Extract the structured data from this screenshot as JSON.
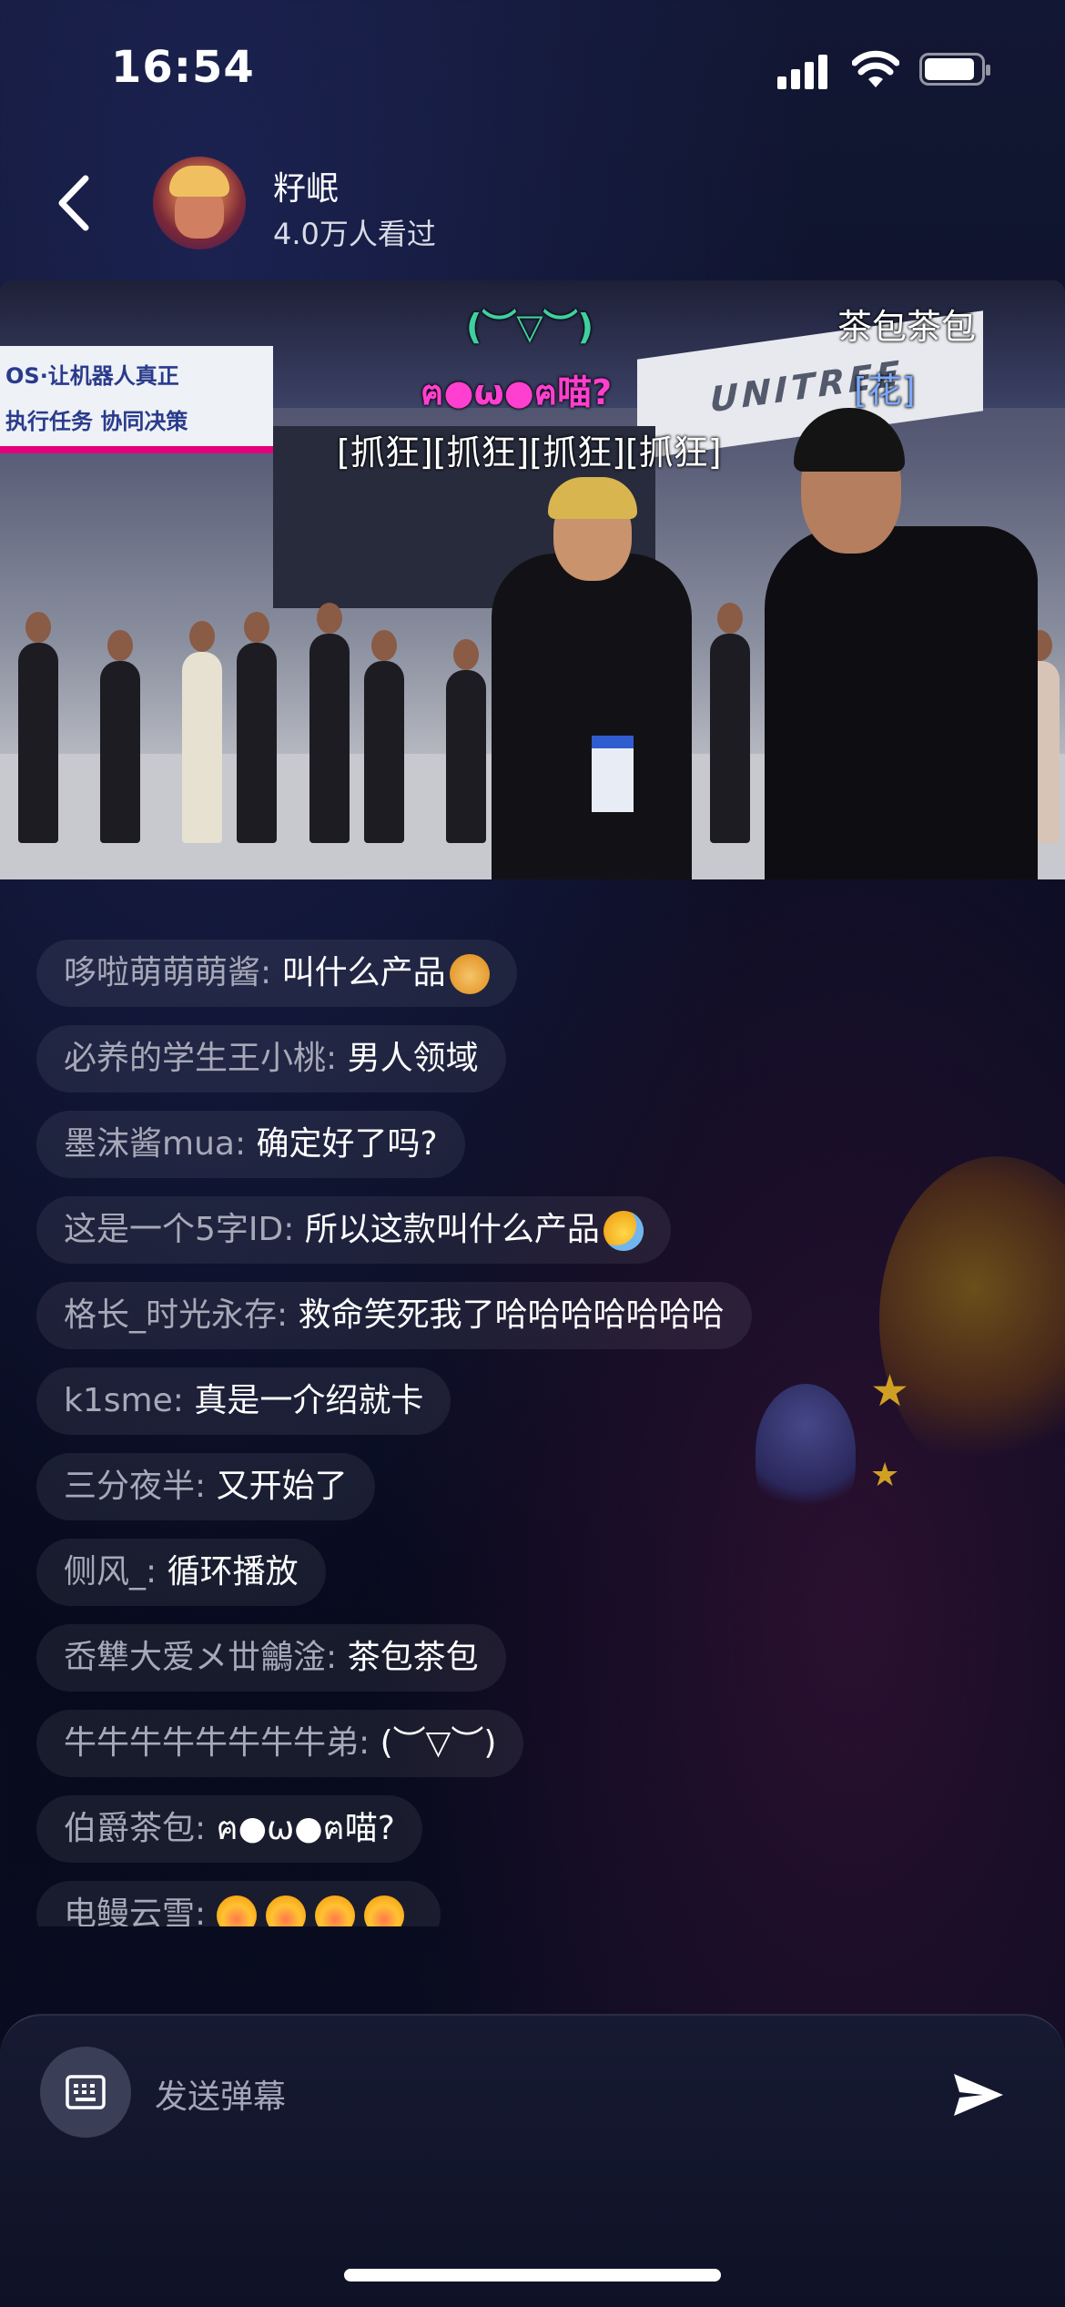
{
  "status_bar": {
    "time": "16:54"
  },
  "header": {
    "streamer_name": "籽岷",
    "viewers": "4.0万人看过"
  },
  "video": {
    "danmaku": [
      {
        "text": "(︶▽︶)",
        "color": "#3fd0a0"
      },
      {
        "text": "ฅ●ω●ฅ喵?",
        "color": "#ff3fd0"
      },
      {
        "text": "[抓狂][抓狂][抓狂][抓狂]",
        "color": "#ffffff"
      },
      {
        "text": "茶包茶包",
        "color": "#ffffff"
      },
      {
        "text": "[花]",
        "color": "#7aa8ff"
      }
    ],
    "sign_left_lines": [
      "OS·让机器人真正",
      "执行任务 协同决策"
    ],
    "sign_right": "UNITREE"
  },
  "comments": [
    {
      "name": "哆啦萌萌萌酱",
      "text": "叫什么产品",
      "emoji": "dog-emoji"
    },
    {
      "name": "必养的学生王小桃",
      "text": "男人领域"
    },
    {
      "name": "墨沫酱mua",
      "text": "确定好了吗?"
    },
    {
      "name": "这是一个5字ID",
      "text": "所以这款叫什么产品",
      "emoji": "sweat-emoji"
    },
    {
      "name": "格长_时光永存",
      "text": "救命笑死我了哈哈哈哈哈哈哈"
    },
    {
      "name": "k1sme",
      "text": "真是一介绍就卡"
    },
    {
      "name": "三分夜半",
      "text": "又开始了"
    },
    {
      "name": "侧风_",
      "text": "循环播放"
    },
    {
      "name": "岙犨大爱メ丗鸙淦",
      "text": "茶包茶包"
    },
    {
      "name": "牛牛牛牛牛牛牛牛弟",
      "text": "(︶▽︶)"
    },
    {
      "name": "伯爵茶包",
      "text": "ฅ●ω●ฅ喵?"
    },
    {
      "name": "电鳗云雪",
      "text": "",
      "emoji": "crying-emoji-x4"
    }
  ],
  "input": {
    "placeholder": "发送弹幕",
    "keyboard_icon": "keyboard-icon",
    "send_icon": "send-icon"
  }
}
